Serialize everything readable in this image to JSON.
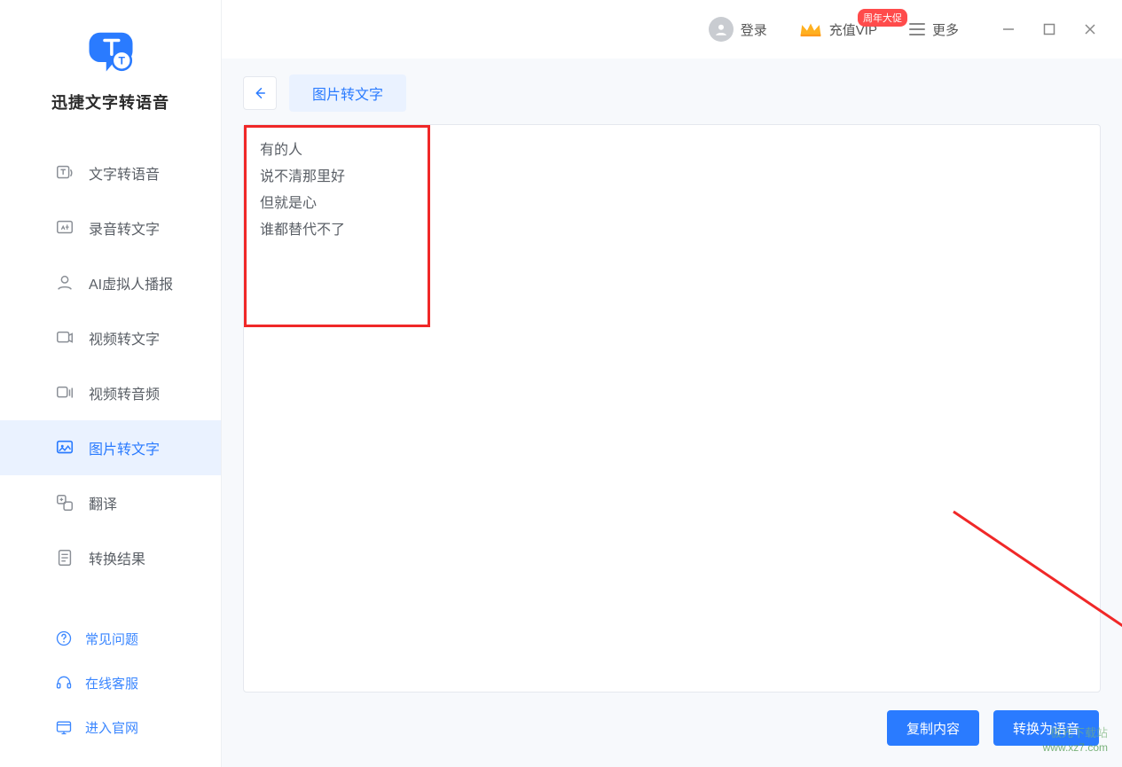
{
  "app": {
    "name": "迅捷文字转语音"
  },
  "nav": {
    "items": [
      {
        "label": "文字转语音",
        "icon": "text-to-speech"
      },
      {
        "label": "录音转文字",
        "icon": "audio-to-text"
      },
      {
        "label": "AI虚拟人播报",
        "icon": "ai-avatar"
      },
      {
        "label": "视频转文字",
        "icon": "video-to-text"
      },
      {
        "label": "视频转音频",
        "icon": "video-to-audio"
      },
      {
        "label": "图片转文字",
        "icon": "image-to-text"
      },
      {
        "label": "翻译",
        "icon": "translate"
      },
      {
        "label": "转换结果",
        "icon": "results"
      }
    ],
    "active_index": 5
  },
  "support": {
    "items": [
      {
        "label": "常见问题",
        "icon": "help"
      },
      {
        "label": "在线客服",
        "icon": "headset"
      },
      {
        "label": "进入官网",
        "icon": "website"
      }
    ]
  },
  "header": {
    "login": "登录",
    "vip": "充值VIP",
    "vip_badge": "周年大促",
    "more": "更多"
  },
  "tabs": {
    "active": "图片转文字"
  },
  "editor": {
    "lines": [
      "有的人",
      "说不清那里好",
      "但就是心",
      "谁都替代不了"
    ]
  },
  "buttons": {
    "copy": "复制内容",
    "to_speech": "转换为语音"
  },
  "watermark": {
    "top": "极光下载站",
    "bottom": "www.xz7.com"
  }
}
